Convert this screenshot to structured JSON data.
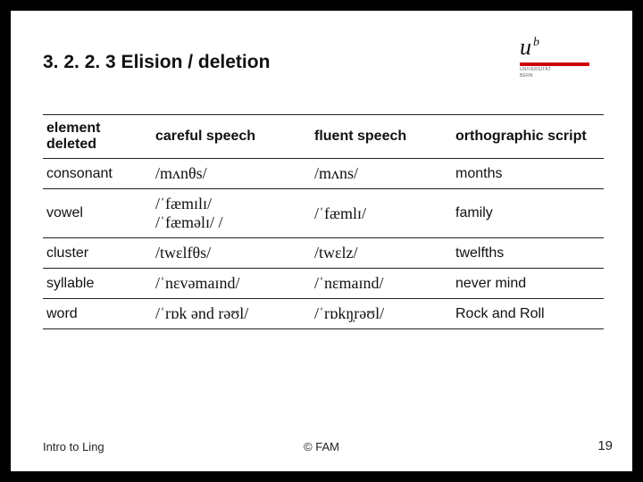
{
  "title": "3. 2. 2. 3 Elision / deletion",
  "logo": {
    "mark": "u",
    "sup": "b",
    "sub1": "UNIVERSITÄT",
    "sub2": "BERN"
  },
  "table": {
    "headers": [
      "element deleted",
      "careful speech",
      "fluent speech",
      "orthographic script"
    ],
    "rows": [
      {
        "element": "consonant",
        "careful": "/mʌnθs/",
        "fluent": "/mʌns/",
        "ortho": "months"
      },
      {
        "element": "vowel",
        "careful": "/ˈfæmɪlɪ/\n/ˈfæməlɪ/ /",
        "fluent": "/ˈfæmlɪ/",
        "ortho": "family"
      },
      {
        "element": "cluster",
        "careful": "/twɛlfθs/",
        "fluent": "/twɛlz/",
        "ortho": "twelfths"
      },
      {
        "element": "syllable",
        "careful": "/ˈnɛvəmaɪnd/",
        "fluent": "/ˈnɛmaɪnd/",
        "ortho": "never mind"
      },
      {
        "element": "word",
        "careful": "/ˈrɒk ənd rəʊl/",
        "fluent": "/ˈrɒkŋ̩rəʊl/",
        "ortho": "Rock and Roll"
      }
    ]
  },
  "footer": {
    "left": "Intro to Ling",
    "center": "© FAM",
    "right": "19"
  }
}
